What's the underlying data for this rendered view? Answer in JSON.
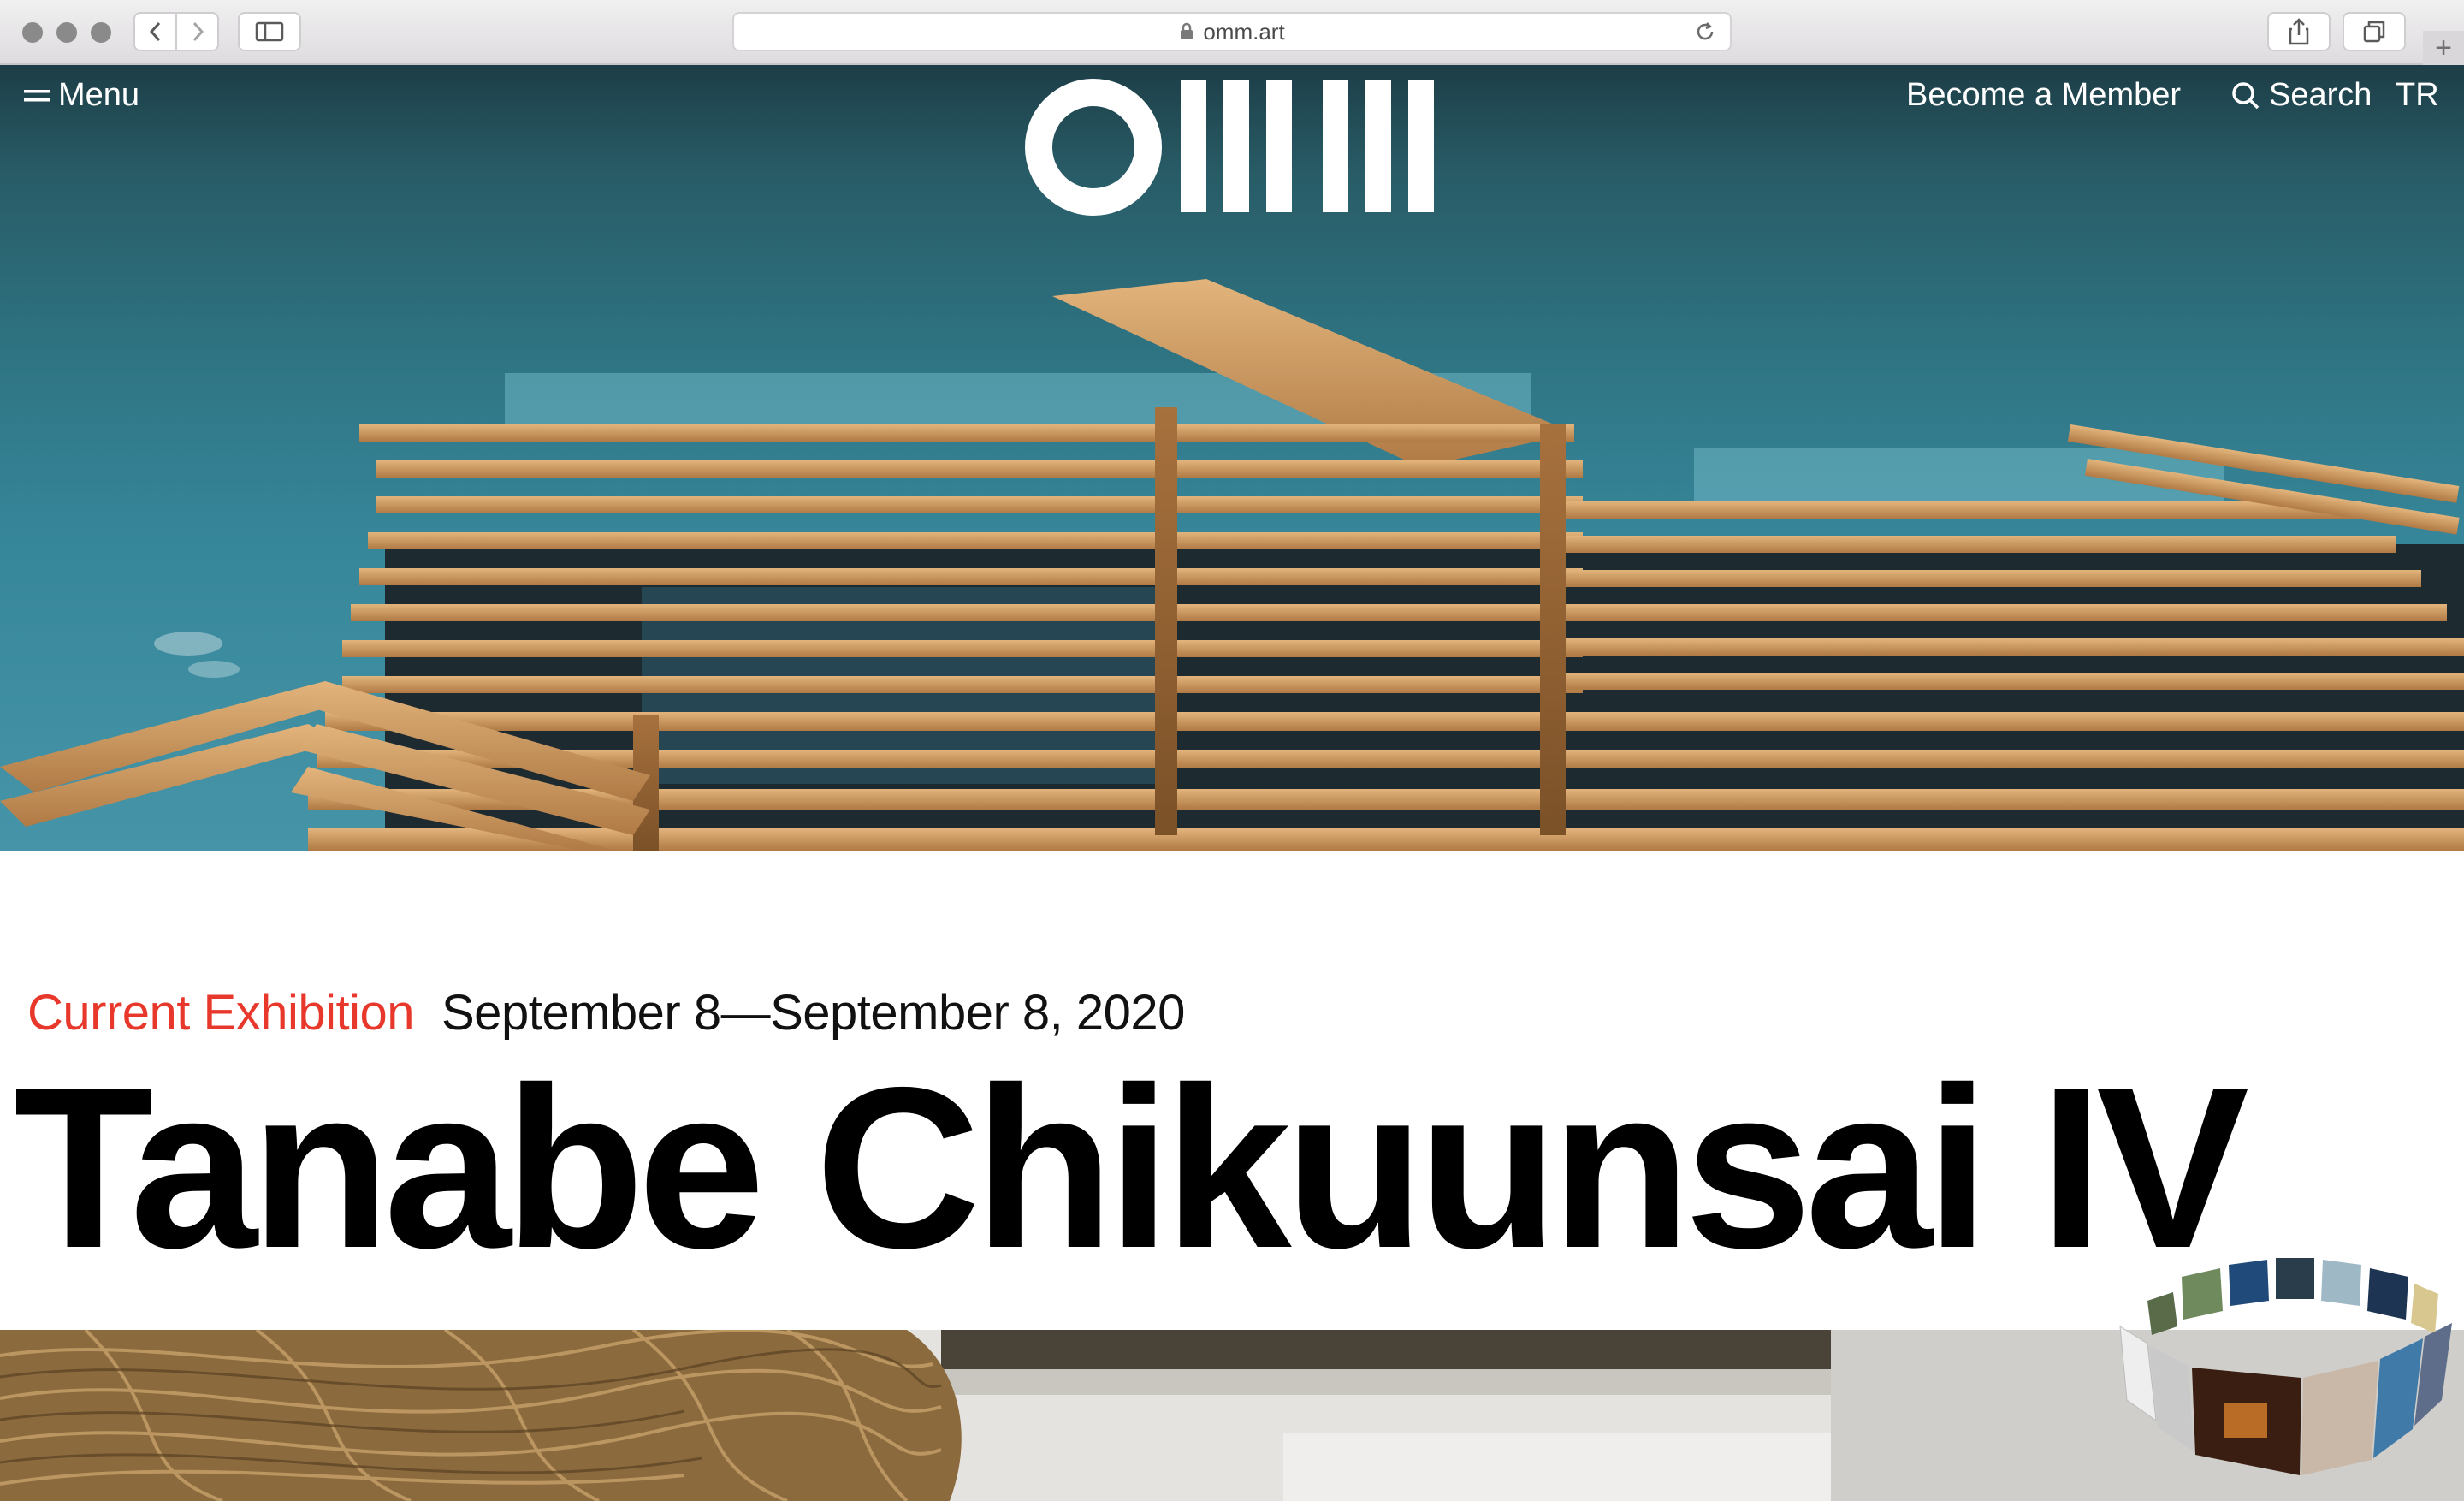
{
  "browser": {
    "url": "omm.art",
    "new_tab": "+"
  },
  "header": {
    "menu_label": "Menu",
    "member_label": "Become a Member",
    "search_label": "Search",
    "lang_label": "TR"
  },
  "exhibition": {
    "kicker": "Current Exhibition",
    "dates": "September 8—September 8, 2020",
    "title": "Tanabe Chikuunsai IV"
  },
  "colors": {
    "accent": "#e8382b",
    "sky": "#2f7584",
    "wood": "#c9975e"
  }
}
